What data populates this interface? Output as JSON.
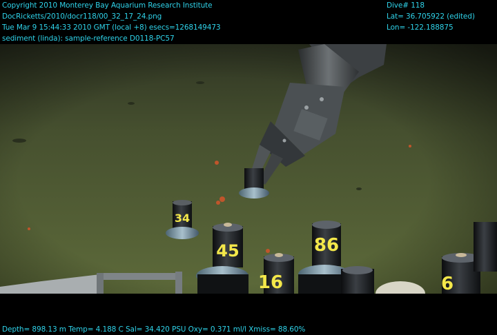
{
  "header": {
    "left_lines": [
      "Copyright 2010 Monterey Bay Aquarium Research Institute",
      "DocRicketts/2010/docr118/00_32_17_24.png",
      "Tue Mar  9 15:44:33 2010 GMT (local +8)  esecs=1268149473",
      "sediment (linda): sample-reference D0118-PC57"
    ],
    "right_lines": [
      "Dive# 118",
      "Lat= 36.705922 (edited)",
      "Lon= -122.188875"
    ]
  },
  "footer": {
    "telemetry": "Depth= 898.13 m  Temp= 4.188 C  Sal= 34.420 PSU  Oxy= 0.371 ml/l  Xmiss= 88.60%"
  },
  "scene": {
    "core_labels": [
      "34",
      "45",
      "16",
      "86",
      "6"
    ],
    "colors": {
      "sediment": "#4f5a36",
      "overlay_text": "#2fd3ea",
      "label": "#f4e84a"
    }
  }
}
